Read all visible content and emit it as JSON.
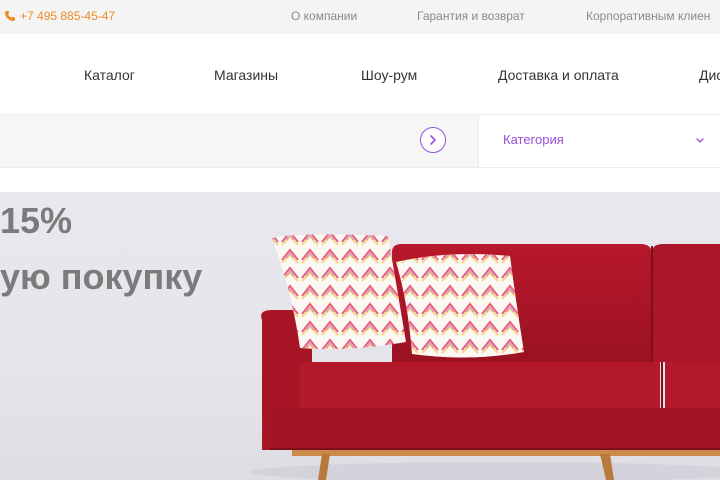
{
  "topbar": {
    "phone": "+7 495 885-45-47",
    "links": [
      "О компании",
      "Гарантия и возврат",
      "Корпоративным клиен"
    ]
  },
  "nav": {
    "items": [
      "Каталог",
      "Магазины",
      "Шоу-рум",
      "Доставка и оплата",
      "Дис"
    ]
  },
  "search": {
    "category_label": "Категория"
  },
  "hero": {
    "line1": "15%",
    "line2": "ую покупку"
  },
  "colors": {
    "accent_purple": "#9b4fd8",
    "phone_orange": "#f08a24",
    "sofa_red": "#b01a2b"
  }
}
